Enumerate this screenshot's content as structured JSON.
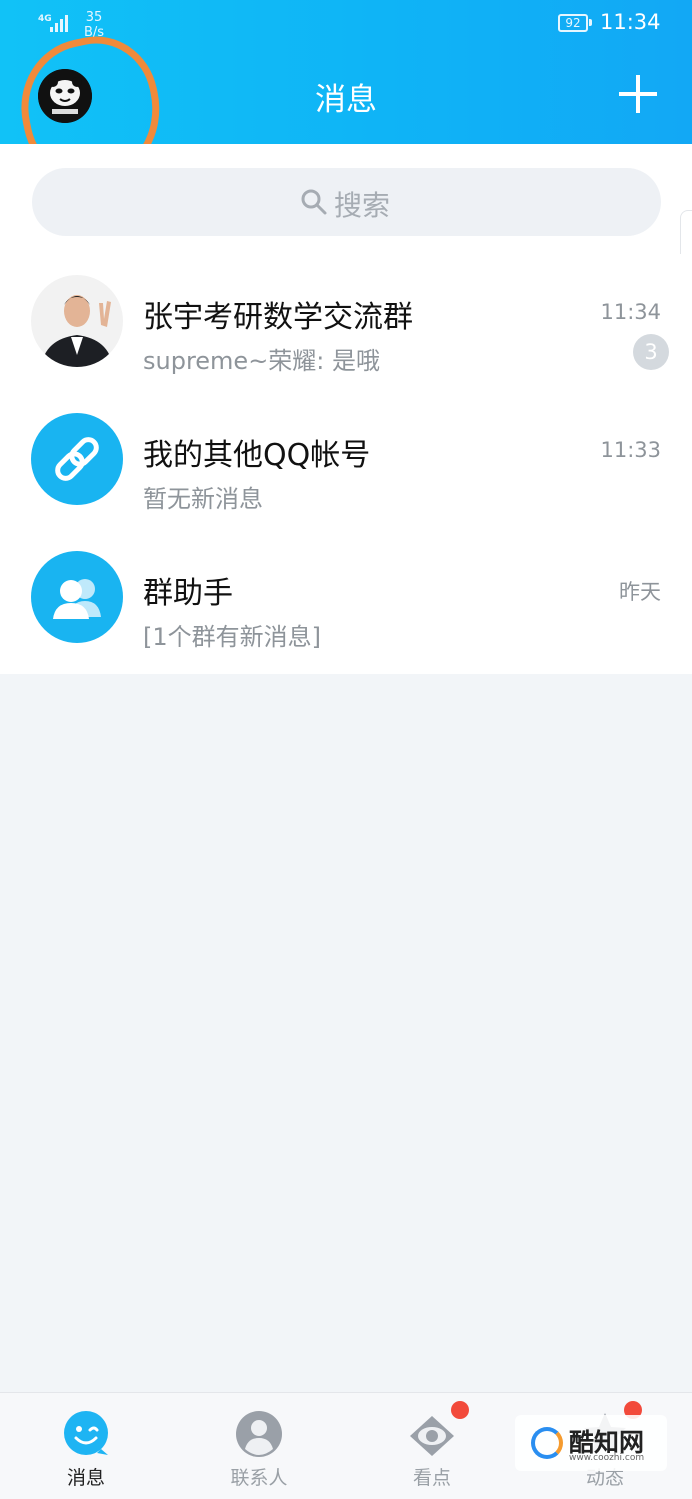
{
  "status_bar": {
    "network_type": "4G",
    "speed_value": "35",
    "speed_unit": "B/s",
    "battery": "92",
    "time": "11:34"
  },
  "header": {
    "title": "消息",
    "avatar_icon": "panda-avatar-icon",
    "add_icon": "plus-icon"
  },
  "search": {
    "placeholder": "搜索"
  },
  "conversations": [
    {
      "title": "张宇考研数学交流群",
      "preview": "supreme~荣耀: 是哦",
      "time": "11:34",
      "unread": "3",
      "avatar": "group-photo-avatar"
    },
    {
      "title": "我的其他QQ帐号",
      "preview": "暂无新消息",
      "time": "11:33",
      "avatar": "link-icon"
    },
    {
      "title": "群助手",
      "preview": "[1个群有新消息]",
      "time": "昨天",
      "avatar": "group-assistant-icon"
    }
  ],
  "tabs": [
    {
      "label": "消息",
      "icon": "messages-icon",
      "active": true
    },
    {
      "label": "联系人",
      "icon": "contacts-icon",
      "active": false
    },
    {
      "label": "看点",
      "icon": "eye-icon",
      "active": false,
      "has_dot": true
    },
    {
      "label": "动态",
      "icon": "star-icon",
      "active": false,
      "has_dot": true
    }
  ],
  "watermark": {
    "brand": "酷知网",
    "url": "www.coozhi.com"
  },
  "colors": {
    "header_blue": "#11c2f7",
    "accent_blue": "#19b4f1",
    "annotation_orange": "#f08a3a",
    "notification_red": "#f24a3b"
  }
}
